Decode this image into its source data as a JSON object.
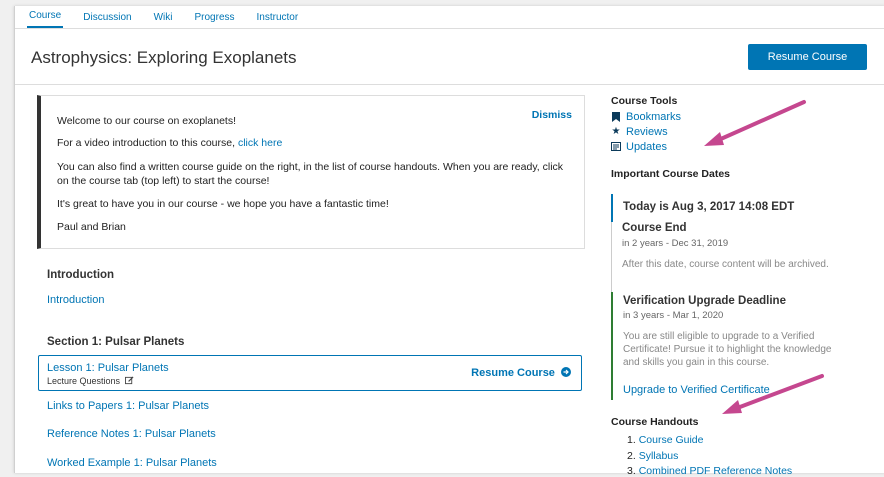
{
  "tabs": [
    "Course",
    "Discussion",
    "Wiki",
    "Progress",
    "Instructor"
  ],
  "header": {
    "title": "Astrophysics: Exploring Exoplanets",
    "resume_label": "Resume Course"
  },
  "welcome": {
    "line1": "Welcome to our course on exoplanets!",
    "dismiss": "Dismiss",
    "line2_prefix": "For a video introduction to this course, ",
    "line2_link": "click here",
    "line3": "You can also find a written course guide on the right, in the list of course handouts. When you are ready, click on the course tab (top left) to start the course!",
    "line4": "It's great to have you in our course - we hope you have a fantastic time!",
    "line5": "Paul and Brian"
  },
  "outline": {
    "intro_title": "Introduction",
    "intro_link": "Introduction",
    "section1_title": "Section 1: Pulsar Planets",
    "lesson_title": "Lesson 1: Pulsar Planets",
    "lesson_sub": "Lecture Questions",
    "lesson_resume": "Resume Course",
    "links": [
      "Links to Papers 1: Pulsar Planets",
      "Reference Notes 1: Pulsar Planets",
      "Worked Example 1: Pulsar Planets"
    ]
  },
  "sidebar": {
    "tools_title": "Course Tools",
    "tools": [
      "Bookmarks",
      "Reviews",
      "Updates"
    ],
    "dates_title": "Important Course Dates",
    "today": "Today is Aug 3, 2017 14:08 EDT",
    "end_title": "Course End",
    "end_sub": "in 2 years - Dec 31, 2019",
    "end_desc": "After this date, course content will be archived.",
    "verif_title": "Verification Upgrade Deadline",
    "verif_sub": "in 3 years - Mar 1, 2020",
    "verif_desc": "You are still eligible to upgrade to a Verified Certificate! Pursue it to highlight the knowledge and skills you gain in this course.",
    "verif_link": "Upgrade to Verified Certificate",
    "handouts_title": "Course Handouts",
    "handouts": [
      "1. ",
      "Course Guide",
      "2. ",
      "Syllabus",
      "3. ",
      "Combined PDF Reference Notes"
    ]
  },
  "colors": {
    "accent": "#0075b4",
    "annotation_arrow": "#c5478f",
    "verified_green": "#2e7d32"
  },
  "icons": {
    "bookmarks": "bookmark-icon",
    "reviews": "star-icon",
    "updates": "newspaper-icon",
    "lesson_edit": "edit-icon",
    "lesson_resume": "arrow-circle-right-icon"
  }
}
